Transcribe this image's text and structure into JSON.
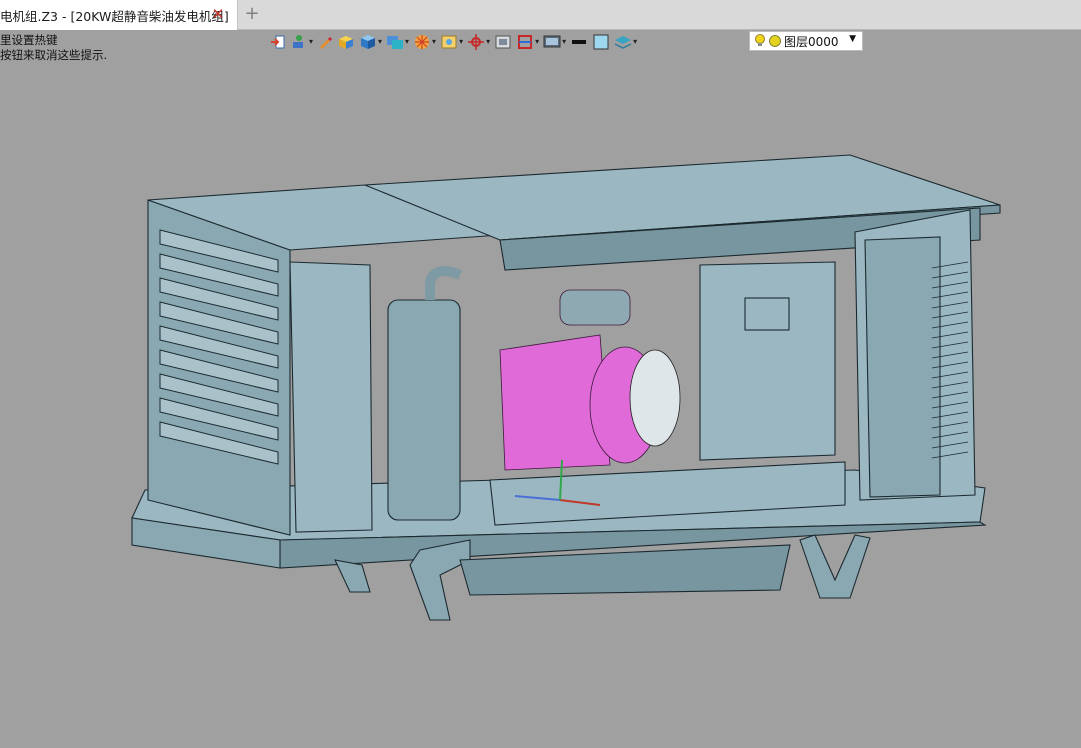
{
  "tab": {
    "title": "电机组.Z3 - [20KW超静音柴油发电机组]",
    "close_symbol": "✕",
    "add_symbol": "+"
  },
  "hint": {
    "line1": "里设置热键",
    "line2": "按钮来取消这些提示."
  },
  "toolbar": {
    "icons": [
      "import-icon",
      "shape-icon",
      "brush-icon",
      "box-icon",
      "cube-icon",
      "material-icon",
      "render-icon",
      "image-icon",
      "axis-icon",
      "screen-icon",
      "section-icon",
      "display-icon",
      "line-color-icon",
      "fill-color-icon",
      "layer-stack-icon"
    ]
  },
  "layer": {
    "value": "图层0000",
    "bulb_color": "#f2d21a",
    "dot_color": "#e3d21f"
  },
  "model": {
    "housing_color": "#9bb8c2",
    "engine_color": "#e06ad8"
  }
}
